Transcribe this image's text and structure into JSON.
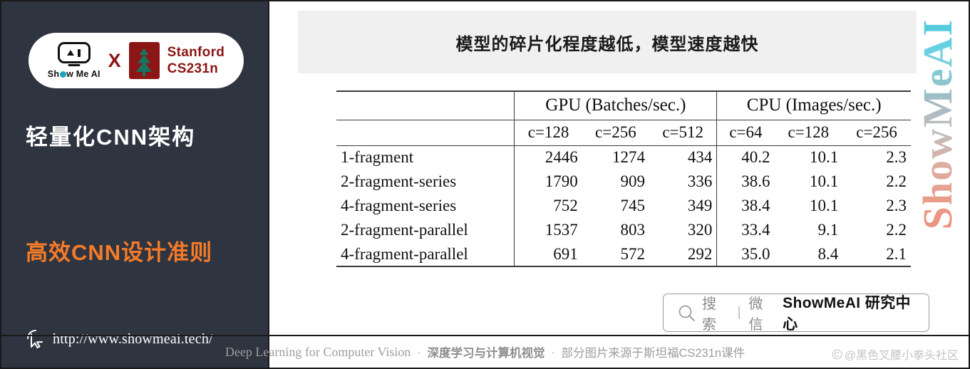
{
  "sidebar": {
    "logo": {
      "showmeai_label": "Show Me AI",
      "cross_label": "X",
      "stanford_line1": "Stanford",
      "stanford_line2": "CS231n",
      "icon_showmeai": "showmeai-robot-icon",
      "icon_stanford": "stanford-tree-icon"
    },
    "heading_primary": "轻量化CNN架构",
    "heading_secondary": "高效CNN设计准则",
    "url": "http://www.showmeai.tech/",
    "cursor_icon": "cursor-pointer-icon",
    "accent_color": "#f47b28",
    "background_color": "#2e3440"
  },
  "banner": {
    "title": "模型的碎片化程度越低，模型速度越快",
    "background_color": "#f0f0f0"
  },
  "chart_data": {
    "type": "table",
    "title": "模型的碎片化程度越低，模型速度越快",
    "row_header": "",
    "column_groups": [
      {
        "label": "GPU (Batches/sec.)",
        "columns": [
          "c=128",
          "c=256",
          "c=512"
        ]
      },
      {
        "label": "CPU (Images/sec.)",
        "columns": [
          "c=64",
          "c=128",
          "c=256"
        ]
      }
    ],
    "categories": [
      "1-fragment",
      "2-fragment-series",
      "4-fragment-series",
      "2-fragment-parallel",
      "4-fragment-parallel"
    ],
    "rows": [
      {
        "label": "1-fragment",
        "values": [
          "2446",
          "1274",
          "434",
          "40.2",
          "10.1",
          "2.3"
        ]
      },
      {
        "label": "2-fragment-series",
        "values": [
          "1790",
          "909",
          "336",
          "38.6",
          "10.1",
          "2.2"
        ]
      },
      {
        "label": "4-fragment-series",
        "values": [
          "752",
          "745",
          "349",
          "38.4",
          "10.1",
          "2.3"
        ]
      },
      {
        "label": "2-fragment-parallel",
        "values": [
          "1537",
          "803",
          "320",
          "33.4",
          "9.1",
          "2.2"
        ]
      },
      {
        "label": "4-fragment-parallel",
        "values": [
          "691",
          "572",
          "292",
          "35.0",
          "8.4",
          "2.1"
        ]
      }
    ],
    "series": [
      {
        "name": "GPU c=128",
        "values": [
          2446,
          1790,
          752,
          1537,
          691
        ]
      },
      {
        "name": "GPU c=256",
        "values": [
          1274,
          909,
          745,
          803,
          572
        ]
      },
      {
        "name": "GPU c=512",
        "values": [
          434,
          336,
          349,
          320,
          292
        ]
      },
      {
        "name": "CPU c=64",
        "values": [
          40.2,
          38.6,
          38.4,
          33.4,
          35.0
        ]
      },
      {
        "name": "CPU c=128",
        "values": [
          10.1,
          10.1,
          10.1,
          9.1,
          8.4
        ]
      },
      {
        "name": "CPU c=256",
        "values": [
          2.3,
          2.2,
          2.3,
          2.2,
          2.1
        ]
      }
    ],
    "grid": false,
    "legend": "none"
  },
  "search_pill": {
    "icon": "search-icon",
    "label_search": "搜索",
    "divider": "|",
    "label_channel": "微信",
    "brand": "ShowMeAI 研究中心"
  },
  "footer": {
    "english": "Deep Learning for Computer Vision",
    "dot1": "·",
    "chinese_bold": "深度学习与计算机视觉",
    "dot2": "·",
    "source": "部分图片来源于斯坦福CS231n课件",
    "watermark": "@黑色叉腰小拳头社区"
  },
  "watermark": {
    "text": "ShowMeAI",
    "gradient_top": "#3fc5dc",
    "gradient_bottom": "#e8927c"
  }
}
